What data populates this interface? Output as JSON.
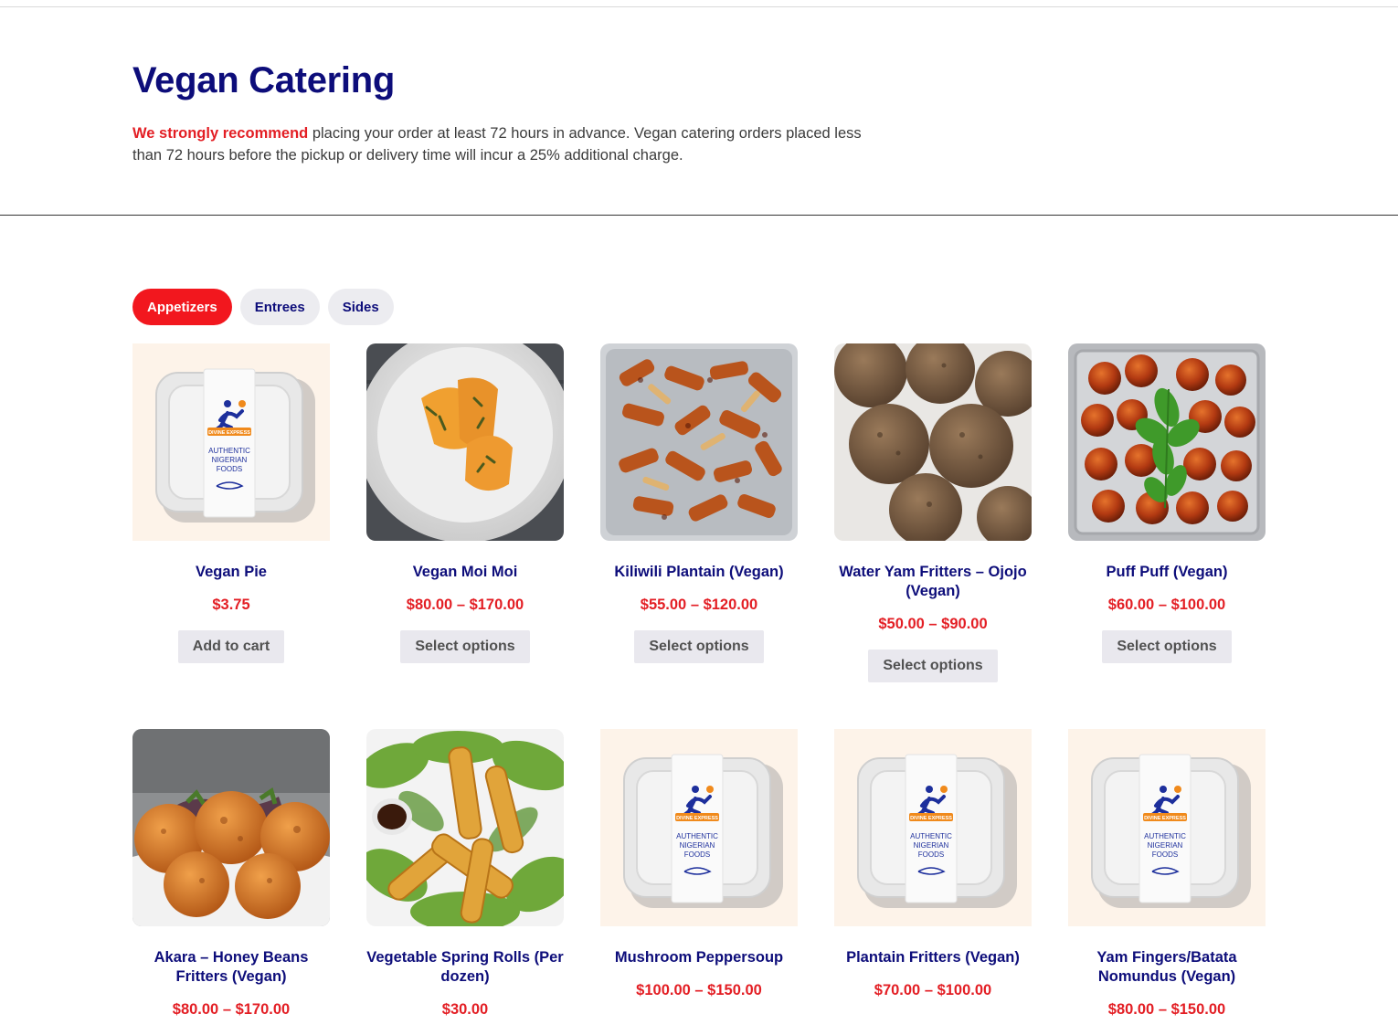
{
  "page": {
    "title": "Vegan Catering",
    "notice_emphasis": "We strongly recommend",
    "notice_rest": " placing your order at least 72 hours in advance. Vegan catering orders placed less than 72 hours before the pickup or delivery time will incur a 25% additional charge."
  },
  "tabs": [
    {
      "label": "Appetizers",
      "active": true
    },
    {
      "label": "Entrees",
      "active": false
    },
    {
      "label": "Sides",
      "active": false
    }
  ],
  "products": [
    {
      "name": "Vegan Pie",
      "price": "$3.75",
      "button": "Add to cart",
      "image": "branded-container"
    },
    {
      "name": "Vegan Moi Moi",
      "price": "$80.00 – $170.00",
      "button": "Select options",
      "image": "moi-moi-plate"
    },
    {
      "name": "Kiliwili Plantain (Vegan)",
      "price": "$55.00 – $120.00",
      "button": "Select options",
      "image": "plantain-tray"
    },
    {
      "name": "Water Yam Fritters – Ojojo (Vegan)",
      "price": "$50.00 – $90.00",
      "button": "Select options",
      "image": "yam-fritters"
    },
    {
      "name": "Puff Puff (Vegan)",
      "price": "$60.00 – $100.00",
      "button": "Select options",
      "image": "puff-puff-tray"
    },
    {
      "name": "Akara – Honey Beans Fritters (Vegan)",
      "price": "$80.00 – $170.00",
      "button": "",
      "image": "akara-plate"
    },
    {
      "name": "Vegetable Spring Rolls (Per dozen)",
      "price": "$30.00",
      "button": "",
      "image": "spring-rolls"
    },
    {
      "name": "Mushroom Peppersoup",
      "price": "$100.00 – $150.00",
      "button": "",
      "image": "branded-container"
    },
    {
      "name": "Plantain Fritters (Vegan)",
      "price": "$70.00 – $100.00",
      "button": "",
      "image": "branded-container"
    },
    {
      "name": "Yam Fingers/Batata Nomundus (Vegan)",
      "price": "$80.00 – $150.00",
      "button": "",
      "image": "branded-container"
    }
  ],
  "container_label": {
    "brand": "DIVINE EXPRESS",
    "line1": "AUTHENTIC",
    "line2": "NIGERIAN",
    "line3": "FOODS"
  },
  "colors": {
    "title": "#0d0d7a",
    "accent": "#e31e24",
    "tab_active": "#f2171e",
    "button_bg": "#e9e8ee"
  }
}
